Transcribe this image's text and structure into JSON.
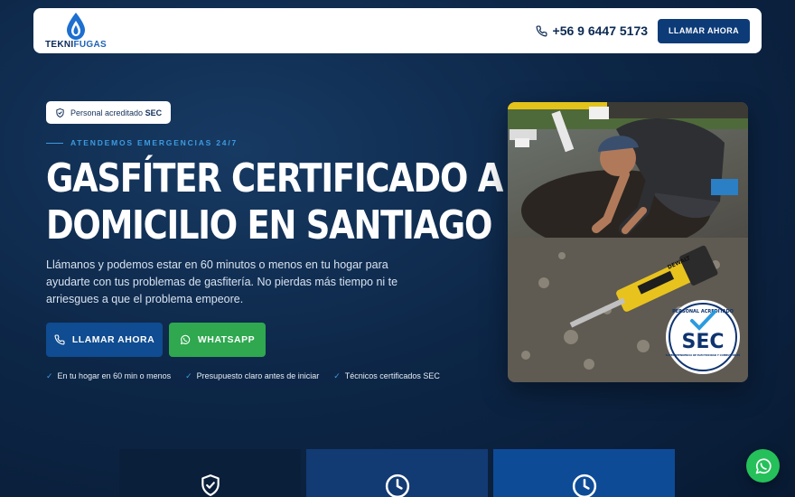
{
  "header": {
    "logo_text_dark": "TEKNI",
    "logo_text_blue": "FUGAS",
    "phone": "+56 9 6447 5173",
    "call_button": "LLAMAR AHORA"
  },
  "hero": {
    "badge_prefix": "Personal acreditado",
    "badge_bold": "SEC",
    "eyebrow": "ATENDEMOS EMERGENCIAS 24/7",
    "title_line1": "GASFÍTER CERTIFICADO A",
    "title_line2": "DOMICILIO EN SANTIAGO",
    "lead": "Llámanos y podemos estar en 60 minutos o menos en tu hogar para ayudarte con tus problemas de gasfitería. No pierdas más tiempo ni te arriesgues a que el problema empeore.",
    "cta_call": "LLAMAR AHORA",
    "cta_whatsapp": "WHATSAPP",
    "checks": [
      "En tu hogar en 60 min o menos",
      "Presupuesto claro antes de iniciar",
      "Técnicos certificados SEC"
    ]
  },
  "photo": {
    "seal_top": "PERSONAL ACREDITADO",
    "seal_main": "SEC",
    "seal_bottom": "SUPERINTENDENCIA DE ELECTRICIDAD Y COMBUSTIBLES",
    "tool_brand": "DEWALT"
  },
  "cards": [
    {
      "icon": "shield-check-icon"
    },
    {
      "icon": "clock-icon"
    },
    {
      "icon": "clock-icon"
    }
  ],
  "colors": {
    "accent": "#3c9be0",
    "primary_button": "#0f4c91",
    "whatsapp": "#2fa84f",
    "background": "#0d2748"
  }
}
